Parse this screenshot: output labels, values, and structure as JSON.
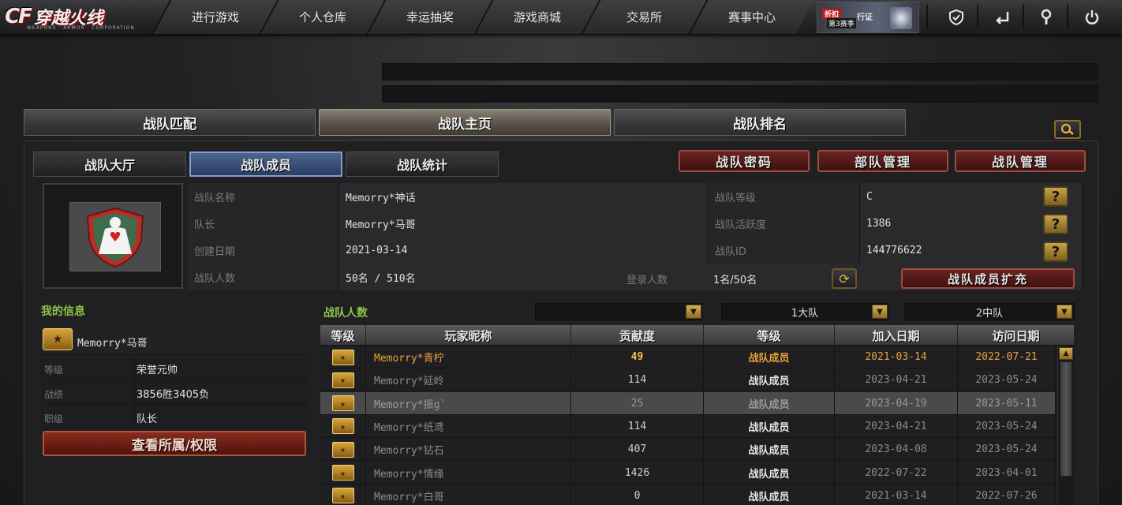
{
  "app": {
    "logo_letters": "CF",
    "logo_title": "穿越火线",
    "logo_subtitle": "WEAPONS · ARMOR · CORPORATION"
  },
  "nav": {
    "items": [
      "进行游戏",
      "个人仓库",
      "幸运抽奖",
      "游戏商城",
      "交易所",
      "赛事中心"
    ],
    "promo": {
      "tag": "折扣",
      "text": "第3赛季",
      "text2": "行证"
    },
    "icons": [
      "shield-icon",
      "exit-icon",
      "wrench-icon",
      "power-icon"
    ]
  },
  "main_tabs": [
    {
      "label": "战队匹配",
      "active": false
    },
    {
      "label": "战队主页",
      "active": true
    },
    {
      "label": "战队排名",
      "active": false
    }
  ],
  "sub_tabs": [
    {
      "label": "战队大厅",
      "active": false
    },
    {
      "label": "战队成员",
      "active": true
    },
    {
      "label": "战队统计",
      "active": false
    }
  ],
  "action_buttons": [
    "战队密码",
    "部队管理",
    "战队管理"
  ],
  "clan_info": {
    "name_label": "战队名称",
    "name_value": "Memorry*神话",
    "leader_label": "队长",
    "leader_value": "Memorry*马哥",
    "created_label": "创建日期",
    "created_value": "2021-03-14",
    "members_label": "战队人数",
    "members_value": "50名 / 510名",
    "login_label": "登录人数",
    "login_value": "1名/50名",
    "level_label": "战队等级",
    "level_value": "C",
    "activity_label": "战队活跃度",
    "activity_value": "1386",
    "id_label": "战队ID",
    "id_value": "144776622",
    "expand_button": "战队成员扩充",
    "help_glyph": "?"
  },
  "my_info": {
    "title": "我的信息",
    "name": "Memorry*马哥",
    "rank_label": "等级",
    "rank_value": "荣誉元帅",
    "record_label": "战绩",
    "record_value": "3856胜3405负",
    "position_label": "职级",
    "position_value": "队长",
    "permission_button": "查看所属/权限"
  },
  "members": {
    "title": "战队人数",
    "filters": [
      "",
      "1大队",
      "2中队"
    ],
    "columns": [
      "等级",
      "玩家昵称",
      "贡献度",
      "等级",
      "加入日期",
      "访问日期"
    ],
    "rows": [
      {
        "nick": "Memorry*青柠",
        "contrib": "49",
        "role": "战队成员",
        "join": "2021-03-14",
        "visit": "2022-07-21",
        "highlight": "first"
      },
      {
        "nick": "Memorry*延岭",
        "contrib": "114",
        "role": "战队成员",
        "join": "2023-04-21",
        "visit": "2023-05-24",
        "highlight": ""
      },
      {
        "nick": "Memorry*振g`",
        "contrib": "25",
        "role": "战队成员",
        "join": "2023-04-19",
        "visit": "2023-05-11",
        "highlight": "selected"
      },
      {
        "nick": "Memorry*纸鸢",
        "contrib": "114",
        "role": "战队成员",
        "join": "2023-04-21",
        "visit": "2023-05-24",
        "highlight": ""
      },
      {
        "nick": "Memorry*钻石",
        "contrib": "407",
        "role": "战队成员",
        "join": "2023-04-08",
        "visit": "2023-05-24",
        "highlight": ""
      },
      {
        "nick": "Memorry*情缘",
        "contrib": "1426",
        "role": "战队成员",
        "join": "2022-07-22",
        "visit": "2023-04-01",
        "highlight": ""
      },
      {
        "nick": "Memorry*白哥",
        "contrib": "0",
        "role": "战队成员",
        "join": "2021-03-14",
        "visit": "2022-07-26",
        "highlight": ""
      }
    ]
  }
}
